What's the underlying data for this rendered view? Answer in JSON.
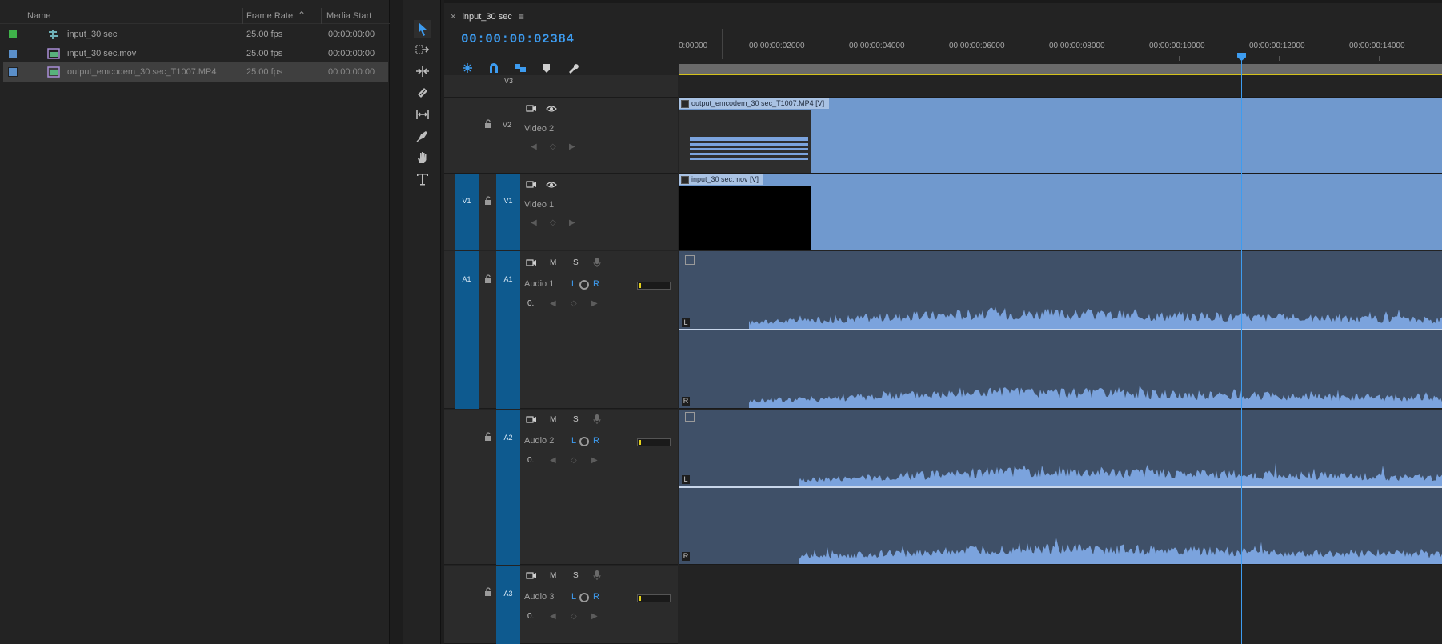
{
  "project": {
    "columns": [
      "Name",
      "Frame Rate",
      "Media Start"
    ],
    "items": [
      {
        "name": "input_30 sec",
        "fps": "25.00 fps",
        "start": "00:00:00:00",
        "color": "#3fb24a",
        "type": "sequence"
      },
      {
        "name": "input_30 sec.mov",
        "fps": "25.00 fps",
        "start": "00:00:00:00",
        "color": "#5b8fc9",
        "type": "video"
      },
      {
        "name": "output_emcodem_30 sec_T1007.MP4",
        "fps": "25.00 fps",
        "start": "00:00:00:00",
        "color": "#5b8fc9",
        "type": "video"
      }
    ]
  },
  "sequence": {
    "tab_close": "×",
    "tab_name": "input_30 sec",
    "tab_menu": "≡",
    "timecode": "00:00:00:02384"
  },
  "ruler": {
    "labels": [
      "0:00000",
      "00:00:00:02000",
      "00:00:00:04000",
      "00:00:00:06000",
      "00:00:00:08000",
      "00:00:00:10000",
      "00:00:00:12000",
      "00:00:00:14000"
    ]
  },
  "tracks": {
    "v3": {
      "label": "V3"
    },
    "v2": {
      "label": "V2",
      "name": "Video 2"
    },
    "v1": {
      "label": "V1",
      "source": "V1",
      "name": "Video 1"
    },
    "a1": {
      "label": "A1",
      "source": "A1",
      "name": "Audio 1"
    },
    "a2": {
      "label": "A2",
      "name": "Audio 2"
    },
    "a3": {
      "label": "A3",
      "name": "Audio 3"
    }
  },
  "track_buttons": {
    "mute": "M",
    "solo": "S",
    "left": "L",
    "right": "R",
    "volume": "0."
  },
  "clips": {
    "v2": "output_emcodem_30 sec_T1007.MP4 [V]",
    "v1": "input_30 sec.mov [V]"
  },
  "channel_labels": {
    "left": "L",
    "right": "R"
  },
  "colors": {
    "accent": "#3d9cf0",
    "target": "#0e5a8f",
    "clip_video": "#7099ce",
    "clip_audio": "#3f5068",
    "waveform": "#7ba3dd"
  }
}
